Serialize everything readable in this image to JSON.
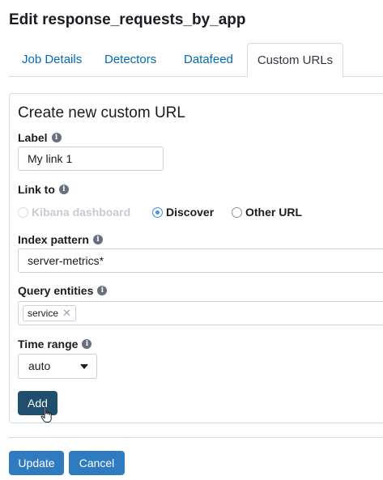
{
  "page": {
    "title": "Edit response_requests_by_app"
  },
  "tabs": [
    {
      "label": "Job Details"
    },
    {
      "label": "Detectors"
    },
    {
      "label": "Datafeed"
    },
    {
      "label": "Custom URLs",
      "active": true
    }
  ],
  "form": {
    "title": "Create new custom URL",
    "label_field": {
      "label": "Label",
      "value": "My link 1"
    },
    "link_to": {
      "label": "Link to",
      "options": [
        {
          "label": "Kibana dashboard",
          "state": "disabled"
        },
        {
          "label": "Discover",
          "state": "checked"
        },
        {
          "label": "Other URL",
          "state": "unchecked"
        }
      ]
    },
    "index_pattern": {
      "label": "Index pattern",
      "value": "server-metrics*"
    },
    "query_entities": {
      "label": "Query entities",
      "items": [
        "service"
      ]
    },
    "time_range": {
      "label": "Time range",
      "value": "auto"
    },
    "add_button": "Add"
  },
  "footer": {
    "update_button": "Update",
    "cancel_button": "Cancel"
  },
  "colors": {
    "link": "#006bb4",
    "add_button": "#1f4e6e",
    "primary_button": "#2e7bbf",
    "radio_checked": "#4a90e2"
  },
  "icons": {
    "info": "info-icon",
    "caret": "caret-down-icon",
    "remove": "close-icon",
    "cursor": "hand-pointer-icon"
  }
}
